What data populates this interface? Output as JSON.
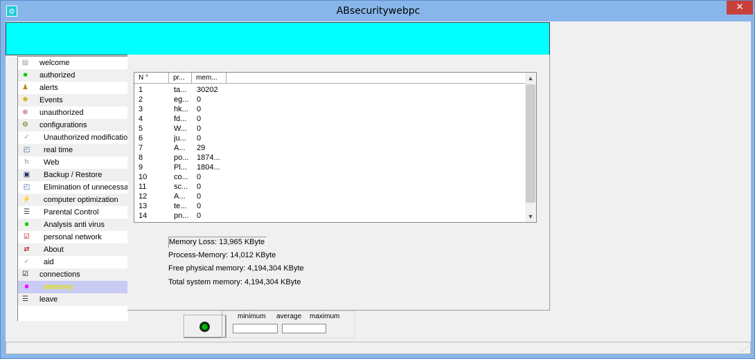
{
  "window": {
    "title": "ABsecuritywebpc",
    "close_symbol": "✕",
    "app_icon": "globe-icon"
  },
  "colors": {
    "banner": "#00ffff",
    "selected_row": "#c8ccf4",
    "selected_text": "#e8e000",
    "title_bar": "#88b6ea",
    "close": "#c7413a"
  },
  "sidebar": {
    "items": [
      {
        "label": "welcome",
        "icon": "doc-icon"
      },
      {
        "label": "authorized",
        "icon": "green-square-icon"
      },
      {
        "label": "alerts",
        "icon": "warning-figure-icon"
      },
      {
        "label": "Events",
        "icon": "lightbulb-icon"
      },
      {
        "label": "unauthorized",
        "icon": "stop-sign-icon"
      },
      {
        "label": "configurations",
        "icon": "config-icon"
      },
      {
        "label": "Unauthorized modifications",
        "icon": "check-mark-icon"
      },
      {
        "label": "real time",
        "icon": "chart-icon"
      },
      {
        "label": "Web",
        "icon": "http-icon"
      },
      {
        "label": "Backup / Restore",
        "icon": "floppy-icon"
      },
      {
        "label": "Elimination of unnecessary files",
        "icon": "chart-icon"
      },
      {
        "label": "computer optimization",
        "icon": "wand-icon"
      },
      {
        "label": "Parental Control",
        "icon": "list-icon"
      },
      {
        "label": "Analysis anti virus",
        "icon": "green-square-icon"
      },
      {
        "label": "personal network",
        "icon": "red-check-icon"
      },
      {
        "label": "About",
        "icon": "arrows-icon"
      },
      {
        "label": "aid",
        "icon": "check-mark-icon"
      },
      {
        "label": "connections",
        "icon": "check-box-icon"
      },
      {
        "label": "memory",
        "icon": "magenta-square-icon"
      },
      {
        "label": "leave",
        "icon": "list-icon"
      }
    ]
  },
  "process_list": {
    "columns": [
      "N °",
      "pr...",
      "mem..."
    ],
    "rows": [
      [
        "1",
        "ta...",
        "30202"
      ],
      [
        "2",
        "eg...",
        "0"
      ],
      [
        "3",
        "hk...",
        "0"
      ],
      [
        "4",
        "fd...",
        "0"
      ],
      [
        "5",
        "W...",
        "0"
      ],
      [
        "6",
        "ju...",
        "0"
      ],
      [
        "7",
        "A...",
        "29"
      ],
      [
        "8",
        "po...",
        "1874..."
      ],
      [
        "9",
        "Pl...",
        "1804..."
      ],
      [
        "10",
        "co...",
        "0"
      ],
      [
        "11",
        "sc...",
        "0"
      ],
      [
        "12",
        "A...",
        "0"
      ],
      [
        "13",
        "te...",
        "0"
      ],
      [
        "14",
        "pn...",
        "0"
      ]
    ],
    "scroll_up": "▲",
    "scroll_down": "▼"
  },
  "memory_info": {
    "loss": "Memory Loss: 13,965 KByte",
    "process": "Process-Memory: 14,012 KByte",
    "free_physical": "Free physical memory: 4,194,304 KByte",
    "total_system": "Total system memory: 4,194,304 KByte"
  },
  "stats": {
    "minimum": "minimum",
    "average": "average",
    "maximum": "maximum"
  }
}
